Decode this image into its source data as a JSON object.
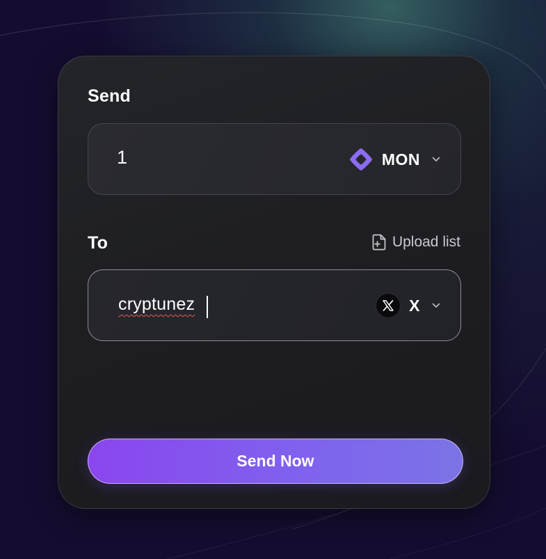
{
  "send_form": {
    "send_label": "Send",
    "amount_value": "1",
    "token": {
      "symbol": "MON",
      "icon": "monad-diamond-icon",
      "color": "#8a6cf0"
    },
    "to_label": "To",
    "upload_label": "Upload list",
    "upload_icon": "file-plus-icon",
    "recipient_value": "cryptunez",
    "platform": {
      "label": "X",
      "icon": "x-logo-icon"
    },
    "submit_label": "Send Now"
  },
  "colors": {
    "background": "#150d30",
    "card": "#1e1e22",
    "accent_start": "#8a46ee",
    "accent_end": "#7b73e6"
  }
}
